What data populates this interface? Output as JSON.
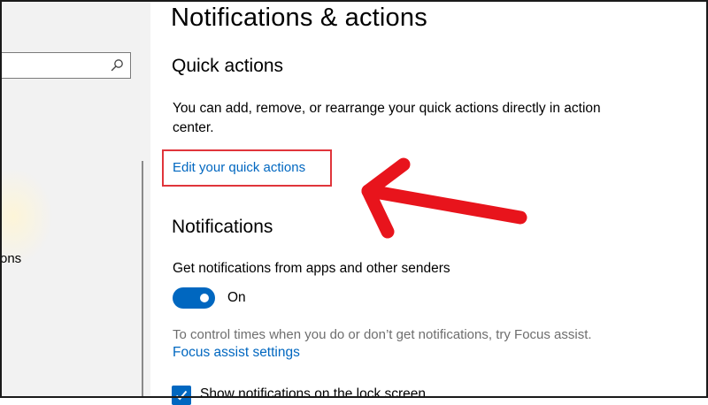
{
  "colors": {
    "accent": "#0067c0",
    "annotation_red": "#e0353b",
    "sidebar_bg": "#f2f2f2",
    "muted_text": "#6e6e6e"
  },
  "sidebar": {
    "search": {
      "value": "",
      "icon": "search-icon"
    },
    "items": [
      {
        "label": "ons"
      }
    ]
  },
  "main": {
    "page_title": "Notifications & actions",
    "quick_actions": {
      "heading": "Quick actions",
      "description": "You can add, remove, or rearrange your quick actions directly in action center.",
      "edit_link": "Edit your quick actions"
    },
    "notifications": {
      "heading": "Notifications",
      "get_notifications_label": "Get notifications from apps and other senders",
      "toggle_state": "On",
      "focus_description": "To control times when you do or don’t get notifications, try Focus assist.",
      "focus_link": "Focus assist settings",
      "lock_screen_label": "Show notifications on the lock screen"
    }
  },
  "annotation": {
    "icon": "red-arrow-icon"
  }
}
